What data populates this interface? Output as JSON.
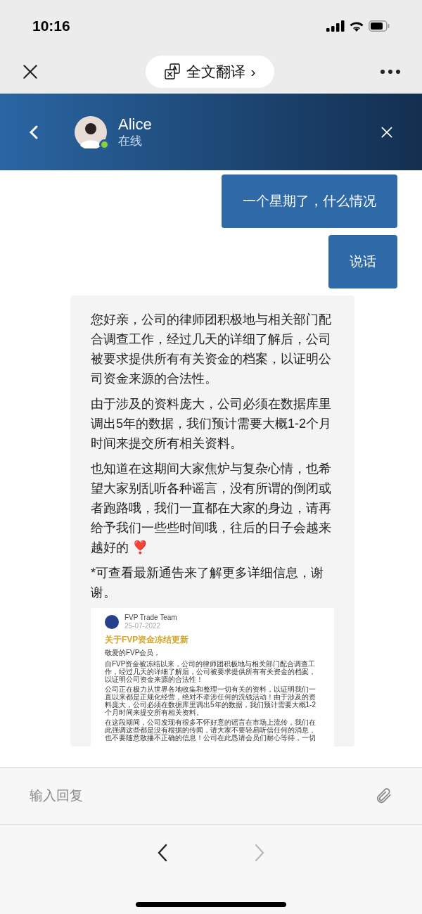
{
  "status_bar": {
    "time": "10:16"
  },
  "top_bar": {
    "translate_label": "全文翻译",
    "translate_arrow": "›"
  },
  "chat_header": {
    "name": "Alice",
    "status": "在线"
  },
  "messages": [
    {
      "kind": "sent",
      "text": "一个星期了，什么情况"
    },
    {
      "kind": "sent",
      "text": "说话"
    },
    {
      "kind": "received",
      "paragraphs": [
        "您好亲，公司的律师团积极地与相关部门配合调查工作，经过几天的详细了解后，公司被要求提供所有有关资金的档案，以证明公司资金来源的合法性。",
        "由于涉及的资料庞大，公司必须在数据库里调出5年的数据，我们预计需要大概1-2个月时间来提交所有相关资料。",
        "也知道在这期间大家焦炉与复杂心情，也希望大家别乱听各种谣言，没有所谓的倒闭或者跑路哦，我们一直都在大家的身边，请再给予我们一些些时间哦，往后的日子会越来越好的 ❣️",
        "*可查看最新通告来了解更多详细信息，谢谢。"
      ],
      "document": {
        "author": "FVP Trade Team",
        "date": "25-07-2022",
        "title": "关于FVP资金冻结更新",
        "greeting": "敬爱的FVP会员，",
        "paragraphs": [
          "自FVP资金被冻结以来，公司的律师团积极地与相关部门配合调查工作，经过几天的详细了解后，公司被要求提供所有有关资金的档案，以证明公司资金来源的合法性！",
          "公司正在极力从世界各地收集和整理一切有关的资料，以证明我们一直以来都是正规化经营，绝对不牵涉任何的洗钱活动！由于涉及的资料庞大，公司必须在数据库里调出5年的数据，我们预计需要大概1-2个月时间来提交所有相关资料。",
          "在这段期间，公司发现有很多不怀好意的谣言在市场上流传，我们在此强调这些都是没有根据的传闻，请大家不要轻易听信任何的消息，也不要随意散播不正确的信息！公司在此恳请会员们耐心等待，一切"
        ]
      }
    }
  ],
  "input": {
    "placeholder": "输入回复"
  },
  "bottom_nav": [
    {
      "kind": "back",
      "disabled": false
    },
    {
      "kind": "forward",
      "disabled": true
    }
  ]
}
